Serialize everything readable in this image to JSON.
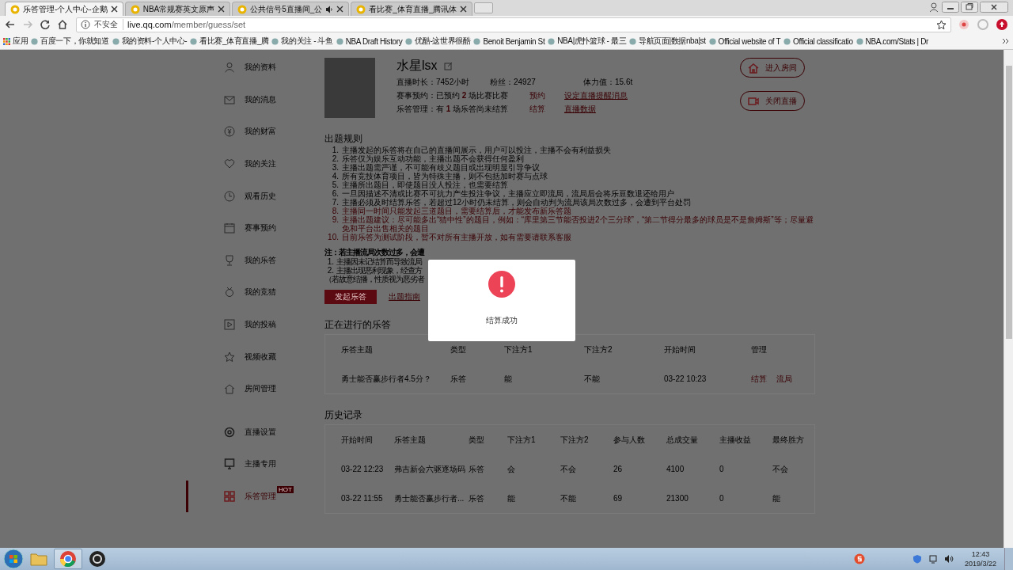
{
  "browser": {
    "tabs": [
      {
        "title": "乐答管理-个人中心-企鹅",
        "selected": true,
        "audio": false
      },
      {
        "title": "NBA常规赛英文原声",
        "selected": false,
        "audio": false
      },
      {
        "title": "公共信号5直播间_公",
        "selected": false,
        "audio": true
      },
      {
        "title": "看比赛_体育直播_腾讯体",
        "selected": false,
        "audio": false
      }
    ],
    "address": {
      "security": "不安全",
      "host": "live.qq.com",
      "path": "/member/guess/set"
    },
    "bookmarks": [
      "应用",
      "百度一下，你就知道",
      "我的资料-个人中心-",
      "看比赛_体育直播_腾",
      "我的关注 - 斗鱼",
      "NBA Draft History",
      "优酷-这世界很酷",
      "Benoit Benjamin St",
      "NBA|虎扑篮球 - 最三",
      "导航页面|数据nba|st",
      "Official website of T",
      "Official classificatio",
      "NBA.com/Stats | Dr"
    ]
  },
  "sidebar": {
    "sections": [
      {
        "items": [
          {
            "label": "我的资料",
            "selected": false
          },
          {
            "label": "我的消息",
            "selected": false
          },
          {
            "label": "我的财富",
            "selected": false
          },
          {
            "label": "我的关注",
            "selected": false
          },
          {
            "label": "观看历史",
            "selected": false
          },
          {
            "label": "赛事预约",
            "selected": false
          },
          {
            "label": "我的乐答",
            "selected": false
          },
          {
            "label": "我的竞猜",
            "selected": false
          },
          {
            "label": "我的投稿",
            "selected": false
          },
          {
            "label": "视频收藏",
            "selected": false
          },
          {
            "label": "房间管理",
            "selected": false
          }
        ]
      },
      {
        "items": [
          {
            "label": "直播设置",
            "selected": false
          },
          {
            "label": "主播专用",
            "selected": false
          },
          {
            "label": "乐答管理",
            "selected": true,
            "badge": "HOT"
          }
        ]
      }
    ]
  },
  "profile": {
    "name": "水星lsx",
    "stats": [
      "直播时长：7452小时",
      "粉丝：24927",
      "体力值：15.6t"
    ],
    "lines": [
      {
        "text": "赛事预约：已预约 **2** 场比赛比赛",
        "action": "预约",
        "link": "设定直播提醒消息"
      },
      {
        "text": "乐答管理：有 **1** 场乐答尚未结算",
        "action": "结算",
        "link": "直播数据"
      }
    ],
    "buttons": [
      "进入房间",
      "关闭直播"
    ]
  },
  "rules": {
    "title": "出题规则",
    "items": [
      {
        "num": "1.",
        "text": "主播发起的乐答将在自己的直播间展示，用户可以投注，主播不会有利益损失",
        "warning": false
      },
      {
        "num": "2.",
        "text": "乐答仅为娱乐互动功能，主播出题不会获得任何盈利",
        "warning": false
      },
      {
        "num": "3.",
        "text": "主播出题需严谨，不可能有歧义题目或出现明显引导争议",
        "warning": false
      },
      {
        "num": "4.",
        "text": "所有竞技体育项目，皆为特殊主播，则不包括加时赛与点球",
        "warning": false
      },
      {
        "num": "5.",
        "text": "主播所出题目，即使题目没人投注，也需要结算",
        "warning": false
      },
      {
        "num": "6.",
        "text": "一旦因描述不清或比赛不可抗力产生投注争议，主播应立即流局，流局后会将乐豆数退还给用户",
        "warning": false
      },
      {
        "num": "7.",
        "text": "主播必须及时结算乐答，若超过12小时仍未结算，则会自动判为流局该局次数过多，会遭到平台处罚",
        "warning": false
      },
      {
        "num": "8.",
        "text": "主播同一时间只能发起三道题目，需要结算后，才能发布新乐答题",
        "warning": true
      },
      {
        "num": "9.",
        "text": "主播出题建议：尽可能多出“猜中性”的题目，例如：“库里第三节能否投进2个三分球”，“第二节得分最多的球员是不是詹姆斯”等；尽量避免和平台出售相关的题目",
        "warning": true
      },
      {
        "num": "10.",
        "text": "目前乐答为测试阶段，暂不对所有主播开放，如有需要请联系客服",
        "warning": true
      }
    ]
  },
  "note": {
    "title": "注：若主播流局次数过多，会遭",
    "items": [
      {
        "num": "1.",
        "text": "主播因未记结算而导致流局"
      },
      {
        "num": "2.",
        "text": "主播出现恶利现象，经查方"
      }
    ],
    "footer": "（若故意结播，性质视为恶劣者"
  },
  "actions": {
    "primary": "发起乐答",
    "link": "出题指南"
  },
  "active": {
    "title": "正在进行的乐答",
    "columns": [
      "乐答主题",
      "类型",
      "下注方1",
      "下注方2",
      "开始时间",
      "管理"
    ],
    "rows": [
      {
        "cells": [
          "勇士能否赢步行者4.5分？",
          "乐答",
          "能",
          "不能",
          "03-22 10:23"
        ],
        "actions": [
          "结算",
          "流局"
        ]
      }
    ]
  },
  "history": {
    "title": "历史记录",
    "columns": [
      "开始时间",
      "乐答主题",
      "类型",
      "下注方1",
      "下注方2",
      "参与人数",
      "总成交量",
      "主播收益",
      "最终胜方"
    ],
    "rows": [
      [
        "03-22 12:23",
        "弗吉新会六驱逐场码",
        "乐答",
        "会",
        "不会",
        "26",
        "4100",
        "0",
        "不会"
      ],
      [
        "03-22 11:55",
        "勇士能否赢步行者...",
        "乐答",
        "能",
        "不能",
        "69",
        "21300",
        "0",
        "能"
      ]
    ]
  },
  "dialog": {
    "message": "结算成功"
  },
  "taskbar": {
    "time": "12:43",
    "date": "2019/3/22"
  }
}
